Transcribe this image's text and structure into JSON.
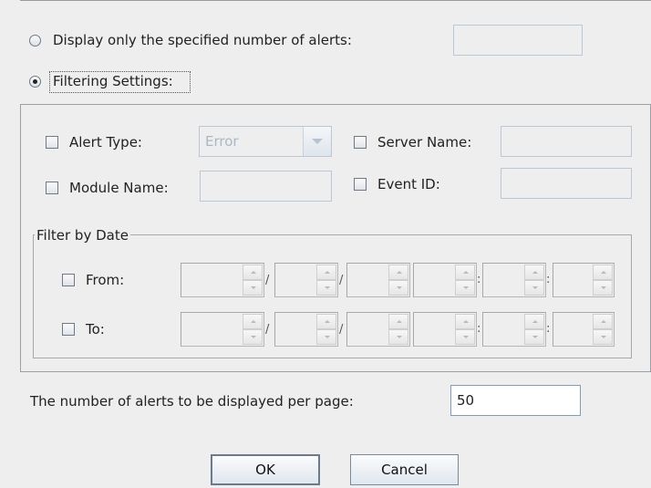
{
  "display_only": {
    "label": "Display only the specified number of alerts:",
    "selected": false,
    "value": ""
  },
  "filtering": {
    "label": "Filtering Settings:",
    "selected": true
  },
  "alert_type": {
    "label": "Alert Type:",
    "checked": false,
    "selected_value": "Error"
  },
  "server_name": {
    "label": "Server Name:",
    "checked": false,
    "value": ""
  },
  "module_name": {
    "label": "Module Name:",
    "checked": false,
    "value": ""
  },
  "event_id": {
    "label": "Event ID:",
    "checked": false,
    "value": ""
  },
  "filter_by_date": {
    "title": "Filter by Date",
    "from_label": "From:",
    "to_label": "To:",
    "date_separator": "/",
    "time_separator": ":"
  },
  "per_page": {
    "label": "The number of alerts to be displayed per page:",
    "value": "50"
  },
  "buttons": {
    "ok": "OK",
    "cancel": "Cancel"
  }
}
